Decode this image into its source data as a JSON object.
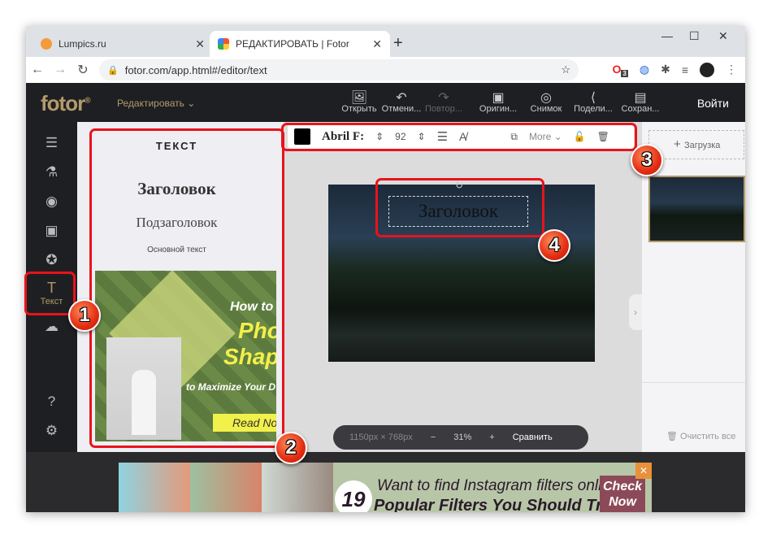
{
  "browser": {
    "tabs": [
      {
        "title": "Lumpics.ru",
        "active": false
      },
      {
        "title": "РЕДАКТИРОВАТЬ | Fotor",
        "active": true
      }
    ],
    "url": "fotor.com/app.html#/editor/text",
    "ext_badge": "3"
  },
  "header": {
    "logo": "fotor",
    "logo_mark": "®",
    "mode": "Редактировать",
    "tools": [
      {
        "label": "Открыть",
        "icon": "open-image-icon"
      },
      {
        "label": "Отмени...",
        "icon": "undo-icon"
      },
      {
        "label": "Повтор...",
        "icon": "redo-icon",
        "disabled": true
      },
      {
        "label": "Оригин...",
        "icon": "original-icon"
      },
      {
        "label": "Снимок",
        "icon": "snapshot-icon"
      },
      {
        "label": "Подели...",
        "icon": "share-icon"
      },
      {
        "label": "Сохран...",
        "icon": "save-icon"
      }
    ],
    "login": "Войти"
  },
  "sidebar": {
    "items": [
      {
        "icon": "adjust-icon"
      },
      {
        "icon": "effects-icon"
      },
      {
        "icon": "beauty-icon"
      },
      {
        "icon": "frame-icon"
      },
      {
        "icon": "sticker-icon"
      },
      {
        "icon": "text-icon",
        "label": "Текст",
        "active": true
      },
      {
        "icon": "upload-cloud-icon"
      }
    ],
    "bottom": [
      {
        "icon": "help-icon"
      },
      {
        "icon": "settings-icon"
      }
    ]
  },
  "panel": {
    "title": "ТЕКСТ",
    "heading": "Заголовок",
    "subheading": "Подзаголовок",
    "body": "Основной текст",
    "banner": {
      "line1": "How to",
      "line2": "Pho",
      "line3": "Shap",
      "line4": "to Maximize Your D",
      "cta": "Read No"
    }
  },
  "text_toolbar": {
    "color": "#000000",
    "font": "Abril F:",
    "size": "92",
    "more": "More"
  },
  "canvas": {
    "text": "Заголовок",
    "dims": "1150px × 768px",
    "zoom": "31%",
    "compare": "Сравнить"
  },
  "right_panel": {
    "upload": "Загрузка",
    "clear": "Очистить все"
  },
  "ad": {
    "number": "19",
    "line1": "Want to find Instagram filters online?",
    "line2": "Popular Filters You Should Try",
    "cta1": "Check",
    "cta2": "Now"
  },
  "annotations": [
    "1",
    "2",
    "3",
    "4"
  ],
  "colors": {
    "accent": "#b39b6a",
    "annotation": "#e8131b"
  }
}
